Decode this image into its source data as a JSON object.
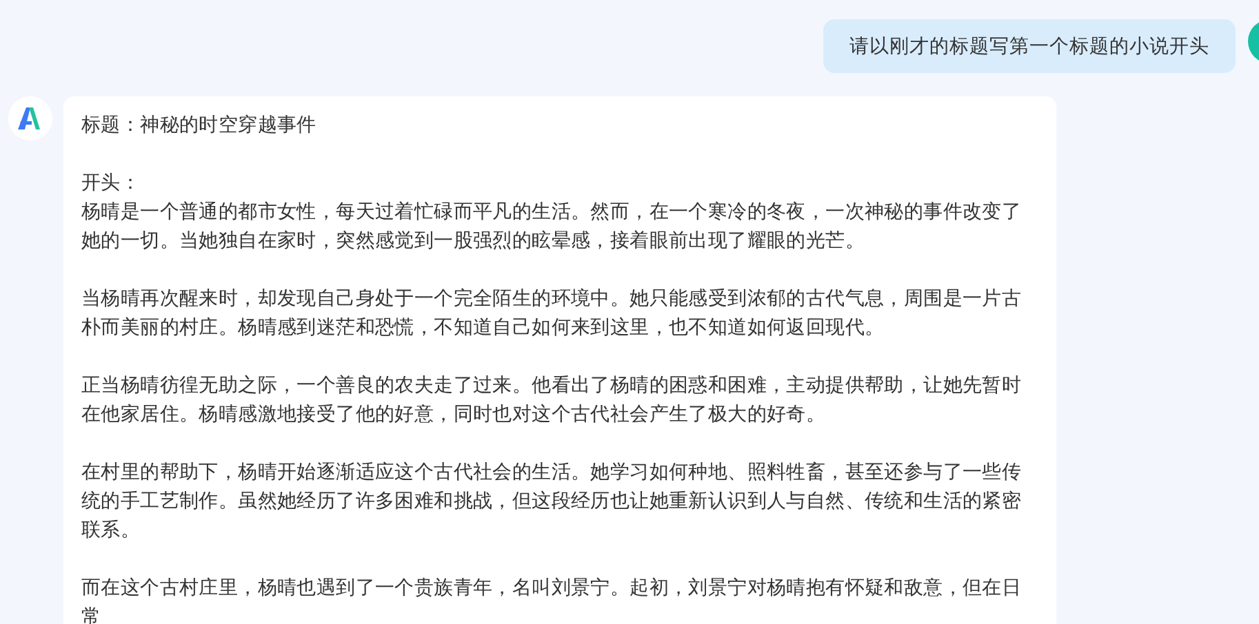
{
  "messages": [
    {
      "kind": "user",
      "text": "请以刚才的标题写第一个标题的小说开头"
    },
    {
      "kind": "assistant",
      "title": "标题：神秘的时空穿越事件",
      "heading": "开头：",
      "paragraphs": [
        "杨晴是一个普通的都市女性，每天过着忙碌而平凡的生活。然而，在一个寒冷的冬夜，一次神秘的事件改变了她的一切。当她独自在家时，突然感觉到一股强烈的眩晕感，接着眼前出现了耀眼的光芒。",
        "当杨晴再次醒来时，却发现自己身处于一个完全陌生的环境中。她只能感受到浓郁的古代气息，周围是一片古朴而美丽的村庄。杨晴感到迷茫和恐慌，不知道自己如何来到这里，也不知道如何返回现代。",
        "正当杨晴彷徨无助之际，一个善良的农夫走了过来。他看出了杨晴的困惑和困难，主动提供帮助，让她先暂时在他家居住。杨晴感激地接受了他的好意，同时也对这个古代社会产生了极大的好奇。",
        "在村里的帮助下，杨晴开始逐渐适应这个古代社会的生活。她学习如何种地、照料牲畜，甚至还参与了一些传统的手工艺制作。虽然她经历了许多困难和挑战，但这段经历也让她重新认识到人与自然、传统和生活的紧密联系。",
        "而在这个古村庄里，杨晴也遇到了一个贵族青年，名叫刘景宁。起初，刘景宁对杨晴抱有怀疑和敌意，但在日常"
      ]
    }
  ]
}
